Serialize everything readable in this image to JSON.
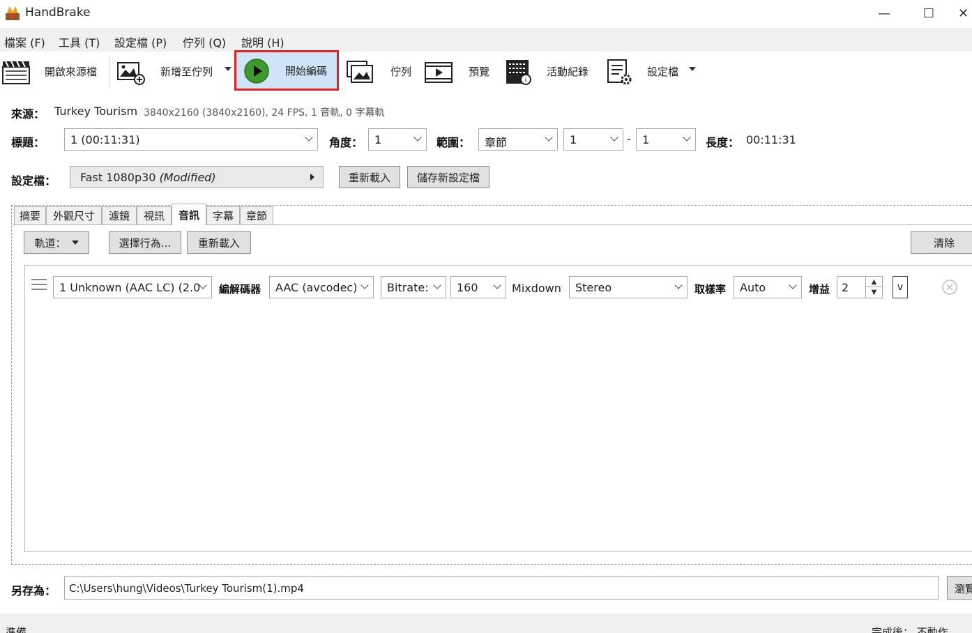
{
  "window": {
    "title": "HandBrake",
    "minimize_glyph": "—",
    "maximize_glyph": "☐",
    "close_glyph": "✕"
  },
  "menu": {
    "items": [
      "檔案 (F)",
      "工具 (T)",
      "設定檔 (P)",
      "佇列 (Q)",
      "說明 (H)"
    ]
  },
  "toolbar": {
    "open_source": "開啟來源檔",
    "add_to_queue": "新增至佇列",
    "start_encode": "開始編碼",
    "queue": "佇列",
    "preview": "預覽",
    "activity_log": "活動紀錄",
    "presets": "設定檔"
  },
  "source": {
    "label": "來源：",
    "name": "Turkey Tourism",
    "info": "3840x2160 (3840x2160), 24 FPS, 1 音軌, 0 字幕軌"
  },
  "title_row": {
    "title_label": "標題：",
    "title_value": "1  (00:11:31)",
    "angle_label": "角度：",
    "angle_value": "1",
    "range_label": "範圍：",
    "range_type": "章節",
    "range_start": "1",
    "range_dash": "-",
    "range_end": "1",
    "duration_label": "長度：",
    "duration_value": "00:11:31"
  },
  "preset_row": {
    "label": "設定檔：",
    "value": "Fast 1080p30",
    "modified": "(Modified)",
    "reload_button": "重新載入",
    "save_new_button": "儲存新設定檔"
  },
  "tabs": {
    "items": [
      "摘要",
      "外觀尺寸",
      "濾鏡",
      "視訊",
      "音訊",
      "字幕",
      "章節"
    ],
    "active_index": 4
  },
  "audio": {
    "tracks_button": "軌道：",
    "select_behavior_button": "選擇行為…",
    "reload_button": "重新載入",
    "clear_button": "清除",
    "track": {
      "source": "1 Unknown (AAC LC) (2.0",
      "codec_label": "編解碼器",
      "codec_value": "AAC (avcodec)",
      "bitrate_mode": "Bitrate:",
      "bitrate_value": "160",
      "mixdown_label": "Mixdown",
      "mixdown_value": "Stereo",
      "samplerate_label": "取樣率",
      "samplerate_value": "Auto",
      "gain_label": "增益",
      "gain_value": "2",
      "more_value": "v"
    }
  },
  "save_as": {
    "label": "另存為：",
    "path": "C:\\Users\\hung\\Videos\\Turkey Tourism(1).mp4",
    "browse_button": "瀏覽"
  },
  "status": {
    "left": "準備",
    "right": "完成後：  不動作"
  }
}
